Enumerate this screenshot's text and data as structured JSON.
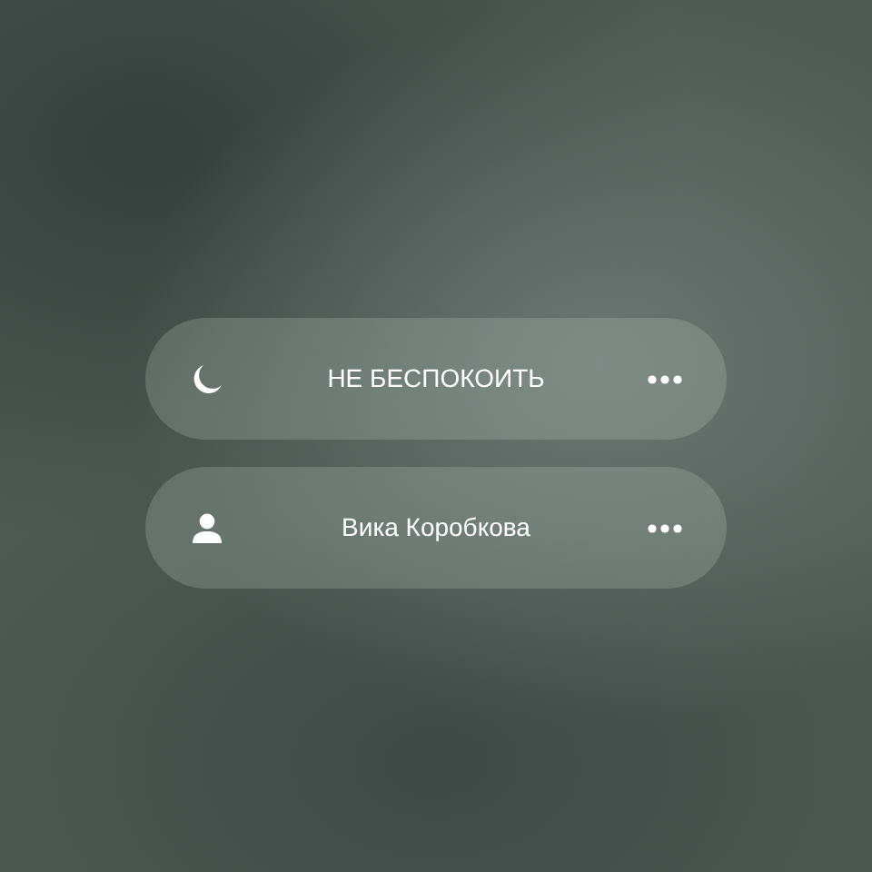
{
  "focus_modes": [
    {
      "kind": "moon",
      "label": "НЕ БЕСПОКОИТЬ"
    },
    {
      "kind": "person",
      "label": "Вика Коробкова"
    }
  ]
}
